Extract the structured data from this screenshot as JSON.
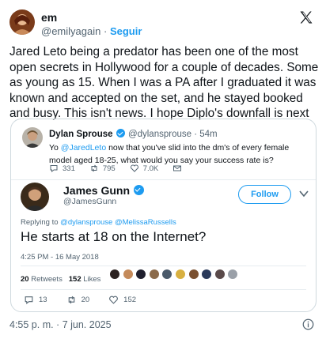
{
  "header": {
    "name": "em",
    "handle": "@emilyagain",
    "separator": "·",
    "follow_label": "Seguir",
    "logo_icon": "x-logo-icon"
  },
  "tweet": {
    "text": "Jared Leto being a predator has been one of the most open secrets in Hollywood for a couple of decades. Some as young as 15. When I was a PA after I graduated it was known and accepted on the set, and he stayed booked and busy. This isn't news. I hope Diplo's downfall is next",
    "timestamp": "4:55 p. m. · 7 jun. 2025"
  },
  "quoted_reply": {
    "name": "Dylan Sprouse",
    "handle_time": "@dylansprouse · 54m",
    "text_prefix": "Yo ",
    "mention": "@JaredLeto",
    "text_rest": " now that you've slid into the dm's of every female model aged 18-25, what would you say your success rate is?",
    "replies": "331",
    "retweets": "795",
    "likes": "7.0K"
  },
  "quoted_main": {
    "name": "James Gunn",
    "handle": "@JamesGunn",
    "follow_label": "Follow",
    "replying_prefix": "Replying to ",
    "replying_mentions": "@dylansprouse @MelissaRussells",
    "text": "He starts at 18 on the Internet?",
    "time": "4:25 PM - 16 May 2018",
    "retweets_count": "20",
    "retweets_label": "Retweets",
    "likes_count": "152",
    "likes_label": "Likes",
    "liker_colors": [
      "#2b2220",
      "#c48a5a",
      "#1f1f2e",
      "#8a6a4a",
      "#4a5a6a",
      "#d8b040",
      "#7a5030",
      "#2a3a5a",
      "#5a4a4a",
      "#9aa0a8"
    ],
    "replies": "13",
    "retweets": "20",
    "likes": "152"
  },
  "colors": {
    "accent": "#1d9bf0",
    "text": "#0f1419",
    "muted": "#536471",
    "border": "#cfd9de"
  }
}
